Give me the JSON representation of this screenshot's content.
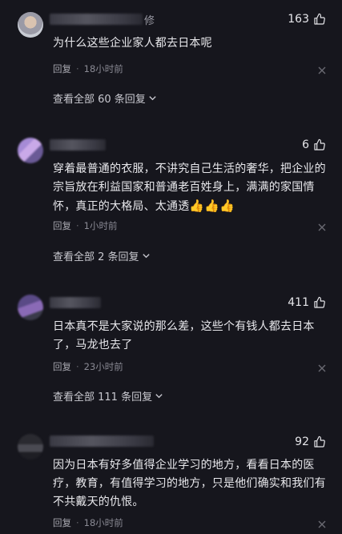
{
  "comments": [
    {
      "likes": "163",
      "name_tail": "修",
      "text": "为什么这些企业家人都去日本呢",
      "reply_label": "回复",
      "time": "18小时前",
      "more_label": "查看全部 60 条回复"
    },
    {
      "likes": "6",
      "text": "穿着最普通的衣服，不讲究自己生活的奢华，把企业的宗旨放在利益国家和普通老百姓身上，满满的家国情怀，真正的大格局、太通透",
      "emoji": "👍👍👍",
      "reply_label": "回复",
      "time": "1小时前",
      "more_label": "查看全部 2 条回复"
    },
    {
      "likes": "411",
      "text": "日本真不是大家说的那么差，这些个有钱人都去日本了，马龙也去了",
      "reply_label": "回复",
      "time": "23小时前",
      "more_label": "查看全部 111 条回复"
    },
    {
      "likes": "92",
      "text": "因为日本有好多值得企业学习的地方，看看日本的医疗，教育，有值得学习的地方，只是他们确实和我们有不共戴天的仇恨。",
      "reply_label": "回复",
      "time": "18小时前"
    }
  ],
  "colors": {
    "background": "#16161d",
    "text": "#e8e8ec",
    "meta": "#8a8a94"
  },
  "icons": {
    "like": "thumbs-up-outline-icon",
    "close": "close-x-icon",
    "expand": "chevron-down-icon"
  }
}
